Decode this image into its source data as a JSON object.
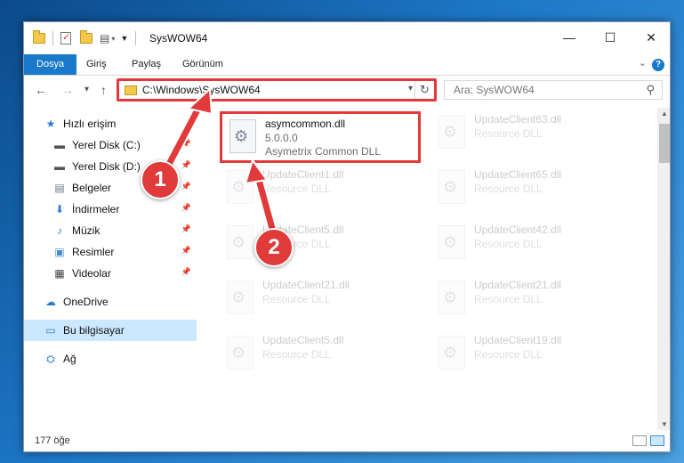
{
  "window": {
    "title": "SysWOW64",
    "minimize": "—",
    "maximize": "☐",
    "close": "✕"
  },
  "ribbon": {
    "tabs": [
      "Dosya",
      "Giriş",
      "Paylaş",
      "Görünüm"
    ],
    "help": "?"
  },
  "nav": {
    "back": "←",
    "forward": "→",
    "recent": "▾",
    "up": "↑",
    "address": "C:\\Windows\\SysWOW64",
    "dropdown": "▾",
    "refresh": "↻",
    "search_placeholder": "Ara: SysWOW64",
    "search_glyph": "⚲"
  },
  "sidebar": {
    "items": [
      {
        "label": "Hızlı erişim",
        "icon": "star-icon",
        "glyph": "★",
        "color": "#2b7cd3"
      },
      {
        "label": "Yerel Disk (C:)",
        "icon": "drive-icon",
        "glyph": "▬",
        "color": "#555555"
      },
      {
        "label": "Yerel Disk (D:)",
        "icon": "drive-icon",
        "glyph": "▬",
        "color": "#555555"
      },
      {
        "label": "Belgeler",
        "icon": "document-icon",
        "glyph": "▤",
        "color": "#6b7a8a"
      },
      {
        "label": "İndirmeler",
        "icon": "download-icon",
        "glyph": "⬇",
        "color": "#2b7cd3"
      },
      {
        "label": "Müzik",
        "icon": "music-icon",
        "glyph": "♪",
        "color": "#2b7cd3"
      },
      {
        "label": "Resimler",
        "icon": "picture-icon",
        "glyph": "▣",
        "color": "#4a8ad4"
      },
      {
        "label": "Videolar",
        "icon": "video-icon",
        "glyph": "▦",
        "color": "#444444"
      },
      {
        "label": "OneDrive",
        "icon": "cloud-icon",
        "glyph": "☁",
        "color": "#2b7cd3"
      },
      {
        "label": "Bu bilgisayar",
        "icon": "computer-icon",
        "glyph": "▭",
        "color": "#2b7cd3"
      },
      {
        "label": "Ağ",
        "icon": "network-icon",
        "glyph": "⛭",
        "color": "#2b7cd3"
      }
    ],
    "pin_glyph": "📌"
  },
  "files": [
    {
      "name": "asymcommon.dll",
      "line1": "5.0.0.0",
      "line2": "Asymetrix Common DLL"
    },
    {
      "name": "UpdateClient63.dll",
      "line1": "Resource DLL"
    },
    {
      "name": "UpdateClient1.dll",
      "line1": "Resource DLL"
    },
    {
      "name": "UpdateClient65.dll",
      "line1": "Resource DLL"
    },
    {
      "name": "UpdateClient5.dll",
      "line1": "Resource DLL"
    },
    {
      "name": "UpdateClient42.dll",
      "line1": "Resource DLL"
    },
    {
      "name": "UpdateClient21.dll",
      "line1": "Resource DLL"
    },
    {
      "name": "UpdateClient21.dll",
      "line1": "Resource DLL"
    },
    {
      "name": "UpdateClient5.dll",
      "line1": "Resource DLL"
    },
    {
      "name": "UpdateClient19.dll",
      "line1": "Resource DLL"
    }
  ],
  "status": {
    "count": "177 öğe"
  },
  "annotations": {
    "step1": "1",
    "step2": "2",
    "highlight_color": "#e03a3a"
  },
  "scroll": {
    "up": "▲",
    "down": "▼"
  }
}
